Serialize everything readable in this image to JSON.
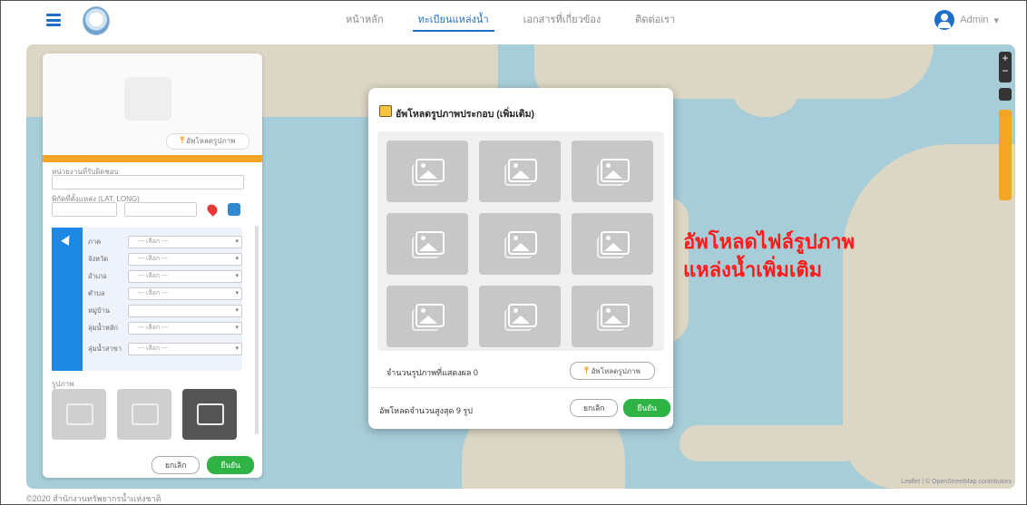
{
  "header": {
    "nav": [
      {
        "label": "หน้าหลัก",
        "active": false
      },
      {
        "label": "ทะเบียนแหล่งน้ำ",
        "active": true
      },
      {
        "label": "เอกสารที่เกี่ยวข้อง",
        "active": false
      },
      {
        "label": "ติดต่อเรา",
        "active": false
      }
    ],
    "user": "Admin"
  },
  "left_panel": {
    "upload_label": "อัพโหลดรูปภาพ",
    "agency_label": "หน่วยงานที่รับผิดชอบ",
    "coords_label": "พิกัดที่ตั้งแหล่ง (LAT, LONG)",
    "address_rows": [
      {
        "label": "ภาค",
        "value": "--- เลือก ---"
      },
      {
        "label": "จังหวัด",
        "value": "--- เลือก ---"
      },
      {
        "label": "อำเภอ",
        "value": "--- เลือก ---"
      },
      {
        "label": "ตำบล",
        "value": "--- เลือก ---"
      },
      {
        "label": "หมู่บ้าน",
        "value": ""
      },
      {
        "label": "ลุ่มน้ำหลัก",
        "value": "--- เลือก ---"
      },
      {
        "label": "ลุ่มน้ำสาขา",
        "value": "--- เลือก ---"
      }
    ],
    "images_label": "รูปภาพ",
    "cancel": "ยกเลิก",
    "confirm": "ยืนยัน"
  },
  "modal": {
    "title": "อัพโหลดรูปภาพประกอบ (เพิ่มเติม)",
    "count_text": "จำนวนรูปภาพที่แสดงผล 0",
    "upload_button": "อัพโหลดรูปภาพ",
    "max_text": "อัพโหลดจำนวนสูงสุด 9 รูป",
    "cancel": "ยกเลิก",
    "confirm": "ยืนยัน"
  },
  "annotation": {
    "line1": "อัพโหลดไฟล์รูปภาพ",
    "line2": "แหล่งน้ำเพิ่มเติม"
  },
  "footer": "©2020 สำนักงานทรัพยากรน้ำแห่งชาติ",
  "map_attribution": "Leaflet | © OpenStreetMap contributors",
  "colors": {
    "primary": "#1f6fc9",
    "accent": "#f5a524",
    "success": "#2fb344",
    "annotation": "#ff1a1a"
  }
}
